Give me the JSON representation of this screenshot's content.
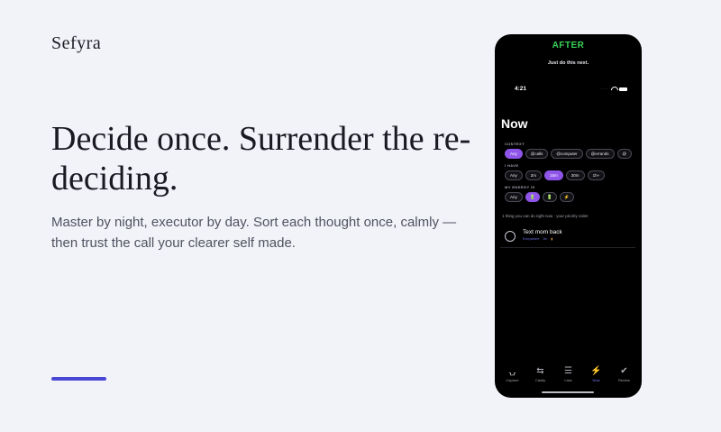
{
  "brand": "Sefyra",
  "hero": {
    "headline": "Decide once. Surrender the re-deciding.",
    "subtitle": "Master by night, executor by day. Sort each thought once, calmly — then trust the call your clearer self made."
  },
  "phone": {
    "banner": "AFTER",
    "tagline": "Just do this next.",
    "status_time": "4:21",
    "screen_title": "Now",
    "context": {
      "label": "CONTEXT",
      "chips": [
        "Any",
        "@calls",
        "@computer",
        "@errands",
        "@"
      ],
      "selected": "Any"
    },
    "time": {
      "label": "I HAVE",
      "chips": [
        "Any",
        "2m",
        "15m",
        "30m",
        "1h+"
      ],
      "selected": "15m"
    },
    "energy": {
      "label": "MY ENERGY IS",
      "chips": [
        "Any",
        "🔋",
        "🔋",
        "⚡"
      ],
      "selected_index": 1
    },
    "recommendation": "1 thing you can do right now · your priority order",
    "task": {
      "title": "Text mom back",
      "meta": [
        "Everywhere",
        "2m"
      ]
    },
    "tabs": [
      {
        "label": "Capture",
        "icon": "inbox-icon"
      },
      {
        "label": "Clarify",
        "icon": "arrows-icon"
      },
      {
        "label": "Lists",
        "icon": "list-icon"
      },
      {
        "label": "Now",
        "icon": "bolt-icon"
      },
      {
        "label": "Review",
        "icon": "check-circle-icon"
      }
    ],
    "active_tab": "Now"
  },
  "colors": {
    "accent": "#4a47d6",
    "after_green": "#37d35a",
    "chip_active": "#8e55e8",
    "tab_active": "#7c76ff"
  }
}
